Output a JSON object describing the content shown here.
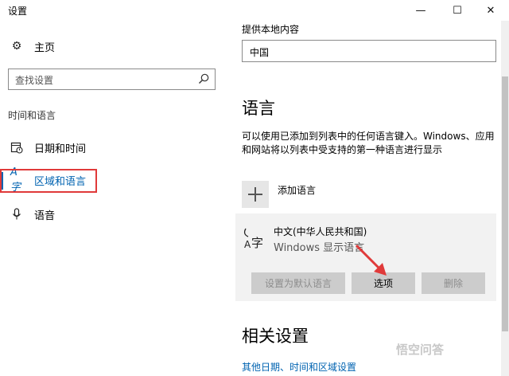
{
  "window": {
    "title": "设置",
    "controls": {
      "minimize": "—",
      "maximize": "☐",
      "close": "✕"
    }
  },
  "sidebar": {
    "home_label": "主页",
    "search_placeholder": "查找设置",
    "section_header": "时间和语言",
    "items": [
      {
        "label": "日期和时间",
        "icon": "calendar-clock-icon"
      },
      {
        "label": "区域和语言",
        "icon": "region-language-icon",
        "active": true
      },
      {
        "label": "语音",
        "icon": "microphone-icon"
      }
    ]
  },
  "content": {
    "local_content_label": "提供本地内容",
    "country_value": "中国",
    "language_heading": "语言",
    "language_desc": "可以使用已添加到列表中的任何语言键入。Windows、应用和网站将以列表中受支持的第一种语言进行显示",
    "add_language_label": "添加语言",
    "language_card": {
      "name": "中文(中华人民共和国)",
      "subtitle": "Windows 显示语言",
      "buttons": {
        "set_default": "设置为默认语言",
        "options": "选项",
        "remove": "删除"
      }
    },
    "related_heading": "相关设置",
    "related_link": "其他日期、时间和区域设置"
  },
  "watermark": "悟空问答",
  "colors": {
    "accent": "#0063b1",
    "highlight": "#e03a3a",
    "card_bg": "#f2f2f2"
  }
}
